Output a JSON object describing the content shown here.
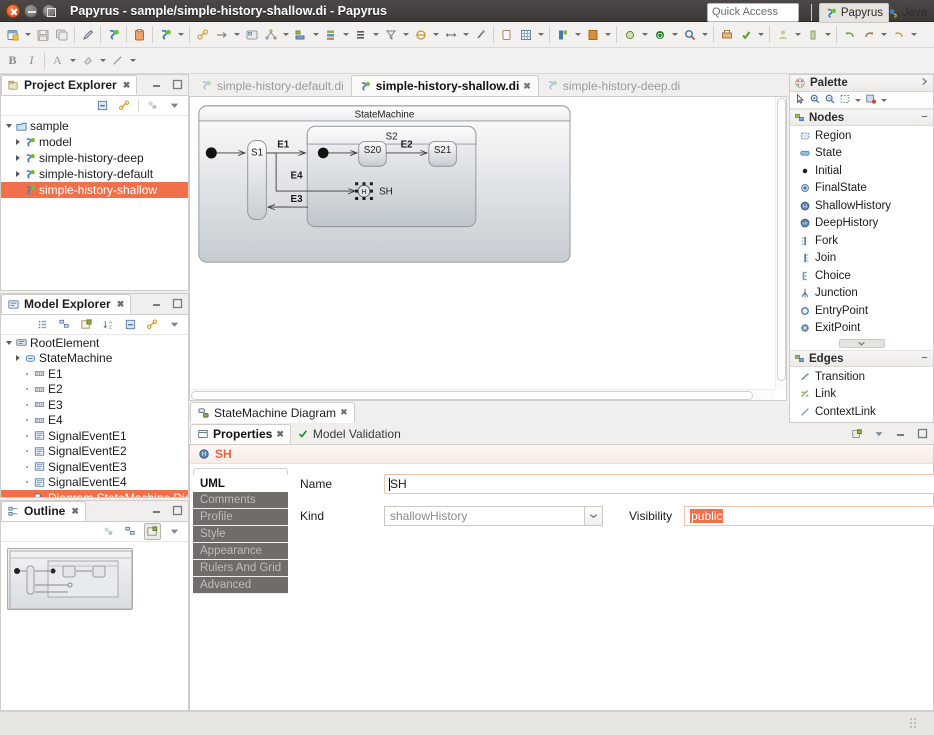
{
  "window": {
    "title": "Papyrus - sample/simple-history-shallow.di - Papyrus",
    "buttons": {
      "close": "close-button",
      "minimize": "minimize-button",
      "maximize": "maximize-button"
    }
  },
  "toolbar": {
    "quick_access_placeholder": "Quick Access",
    "perspectives": [
      {
        "label": "Papyrus",
        "active": true
      },
      {
        "label": "Java",
        "active": false
      }
    ],
    "row2_items": [
      "B",
      "I",
      "A",
      "fill",
      "line"
    ]
  },
  "project_explorer": {
    "tab_label": "Project Explorer",
    "tree": [
      {
        "label": "sample",
        "indent": 0,
        "expander": "open",
        "icon": "project-icon"
      },
      {
        "label": "model",
        "indent": 1,
        "expander": "closed",
        "icon": "papyrus-model-icon"
      },
      {
        "label": "simple-history-deep",
        "indent": 1,
        "expander": "closed",
        "icon": "papyrus-model-icon"
      },
      {
        "label": "simple-history-default",
        "indent": 1,
        "expander": "closed",
        "icon": "papyrus-model-icon"
      },
      {
        "label": "simple-history-shallow",
        "indent": 1,
        "expander": "none",
        "icon": "papyrus-model-icon",
        "selected": true
      }
    ]
  },
  "model_explorer": {
    "tab_label": "Model Explorer",
    "tree": [
      {
        "label": "RootElement",
        "indent": 0,
        "expander": "open",
        "icon": "model-icon"
      },
      {
        "label": "StateMachine",
        "indent": 1,
        "expander": "closed",
        "icon": "statemachine-icon"
      },
      {
        "label": "E1",
        "indent": 2,
        "expander": "none",
        "icon": "signal-icon"
      },
      {
        "label": "E2",
        "indent": 2,
        "expander": "none",
        "icon": "signal-icon"
      },
      {
        "label": "E3",
        "indent": 2,
        "expander": "none",
        "icon": "signal-icon"
      },
      {
        "label": "E4",
        "indent": 2,
        "expander": "none",
        "icon": "signal-icon"
      },
      {
        "label": "SignalEventE1",
        "indent": 2,
        "expander": "none",
        "icon": "signal-event-icon"
      },
      {
        "label": "SignalEventE2",
        "indent": 2,
        "expander": "none",
        "icon": "signal-event-icon"
      },
      {
        "label": "SignalEventE3",
        "indent": 2,
        "expander": "none",
        "icon": "signal-event-icon"
      },
      {
        "label": "SignalEventE4",
        "indent": 2,
        "expander": "none",
        "icon": "signal-event-icon"
      },
      {
        "label": "Diagram StateMachine Diagra",
        "indent": 2,
        "expander": "none",
        "icon": "diagram-icon",
        "selected": true
      }
    ]
  },
  "outline": {
    "tab_label": "Outline"
  },
  "editor": {
    "tabs": [
      {
        "label": "simple-history-default.di",
        "active": false
      },
      {
        "label": "simple-history-shallow.di",
        "active": true
      },
      {
        "label": "simple-history-deep.di",
        "active": false
      }
    ],
    "diagram_tab": "StateMachine Diagram"
  },
  "diagram": {
    "statemachine_name": "StateMachine",
    "composite_state_name": "S2",
    "states": [
      {
        "id": "S1",
        "label": "S1"
      },
      {
        "id": "S20",
        "label": "S20"
      },
      {
        "id": "S21",
        "label": "S21"
      }
    ],
    "history": {
      "label": "SH",
      "glyph": "H",
      "selected": true
    },
    "transitions": [
      {
        "label": "E1",
        "from": "S1",
        "to": "S2"
      },
      {
        "label": "E2",
        "from": "S20",
        "to": "S21"
      },
      {
        "label": "E4",
        "from": "S1",
        "to": "SH"
      },
      {
        "label": "E3",
        "from": "S2",
        "to": "S1"
      }
    ]
  },
  "palette": {
    "title": "Palette",
    "tools": [
      "select-tool",
      "zoom-in-tool",
      "zoom-out-tool",
      "marquee-tool",
      "format-tool"
    ],
    "sections": [
      {
        "title": "Nodes",
        "items": [
          {
            "label": "Region",
            "icon": "region-icon"
          },
          {
            "label": "State",
            "icon": "state-icon"
          },
          {
            "label": "Initial",
            "icon": "initial-icon"
          },
          {
            "label": "FinalState",
            "icon": "finalstate-icon"
          },
          {
            "label": "ShallowHistory",
            "icon": "shallowhistory-icon"
          },
          {
            "label": "DeepHistory",
            "icon": "deephistory-icon"
          },
          {
            "label": "Fork",
            "icon": "fork-icon"
          },
          {
            "label": "Join",
            "icon": "join-icon"
          },
          {
            "label": "Choice",
            "icon": "choice-icon"
          },
          {
            "label": "Junction",
            "icon": "junction-icon"
          },
          {
            "label": "EntryPoint",
            "icon": "entrypoint-icon"
          },
          {
            "label": "ExitPoint",
            "icon": "exitpoint-icon"
          }
        ]
      },
      {
        "title": "Edges",
        "items": [
          {
            "label": "Transition",
            "icon": "transition-icon"
          },
          {
            "label": "Link",
            "icon": "link-icon"
          },
          {
            "label": "ContextLink",
            "icon": "contextlink-icon"
          }
        ]
      }
    ]
  },
  "properties": {
    "tabs": [
      {
        "label": "Properties",
        "active": true
      },
      {
        "label": "Model Validation",
        "active": false
      }
    ],
    "selected_element": "SH",
    "sidebar_tabs": [
      {
        "label": "UML",
        "active": true
      },
      {
        "label": "Comments",
        "active": false
      },
      {
        "label": "Profile",
        "active": false
      },
      {
        "label": "Style",
        "active": false
      },
      {
        "label": "Appearance",
        "active": false
      },
      {
        "label": "Rulers And Grid",
        "active": false
      },
      {
        "label": "Advanced",
        "active": false
      }
    ],
    "fields": {
      "name_label": "Name",
      "name_value": "SH",
      "kind_label": "Kind",
      "kind_value": "shallowHistory",
      "visibility_label": "Visibility",
      "visibility_value": "public"
    }
  },
  "colors": {
    "selection_orange": "#f1704a",
    "title_bar": "#3c3937",
    "panel_bg": "#f0efee"
  }
}
